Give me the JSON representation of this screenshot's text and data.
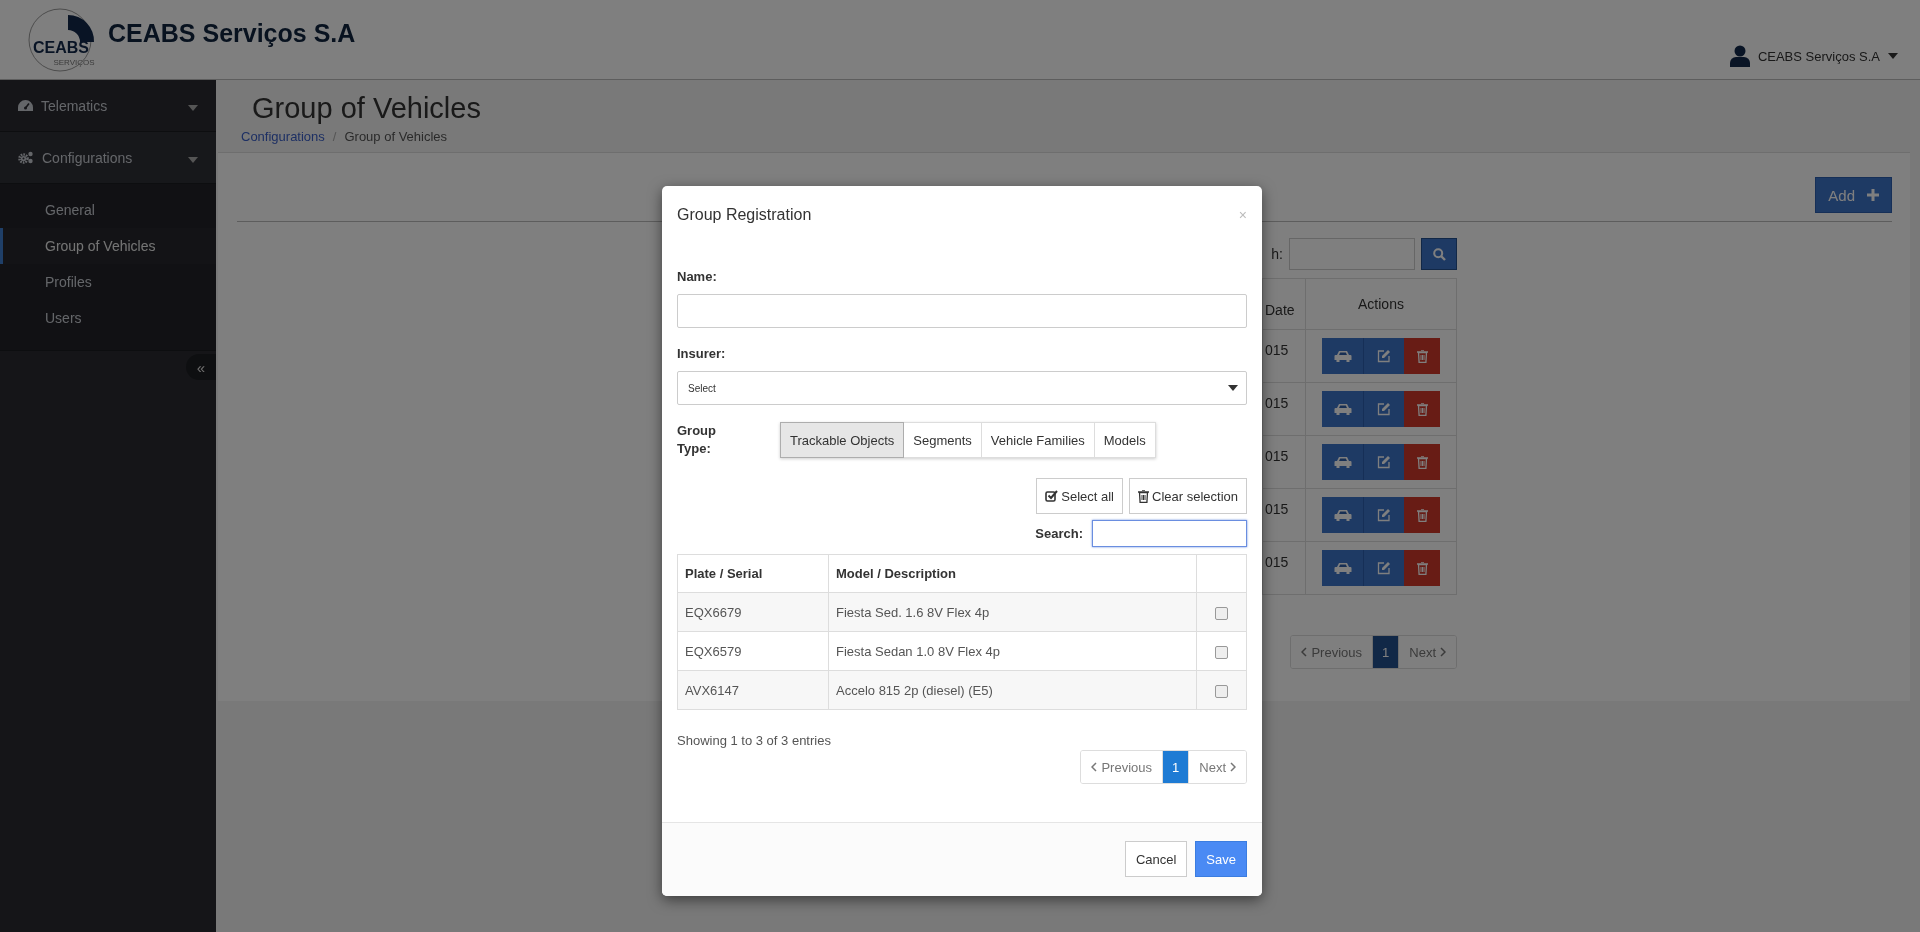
{
  "header": {
    "logo": {
      "text": "CEABS",
      "subtext": "SERVIÇOS"
    },
    "title": "CEABS Serviços S.A",
    "user": "CEABS Serviços S.A"
  },
  "sidebar": {
    "items": [
      {
        "label": "Telematics",
        "kind": "gauge"
      },
      {
        "label": "Configurations",
        "kind": "gears",
        "children": [
          {
            "label": "General",
            "selected": false
          },
          {
            "label": "Group of Vehicles",
            "selected": true
          },
          {
            "label": "Profiles",
            "selected": false
          },
          {
            "label": "Users",
            "selected": false
          }
        ]
      }
    ],
    "collapse_button": "«"
  },
  "page": {
    "title": "Group of Vehicles",
    "breadcrumb": [
      {
        "label": "Configurations",
        "kind": "link"
      },
      {
        "label": "Group of Vehicles",
        "kind": "current"
      }
    ],
    "breadcrumb_separator": "/"
  },
  "panel": {
    "add_button": "Add",
    "search_label": "h:",
    "table": {
      "columns": [
        "Date",
        "Actions"
      ],
      "rows": [
        {
          "date": "015"
        },
        {
          "date": "015"
        },
        {
          "date": "015"
        },
        {
          "date": "015"
        },
        {
          "date": "015"
        }
      ]
    },
    "pagination": {
      "previous": "Previous",
      "pages": [
        {
          "label": "1",
          "selected": true
        }
      ],
      "next": "Next"
    }
  },
  "modal": {
    "title": "Group Registration",
    "close": "×",
    "name": {
      "label": "Name:"
    },
    "insurer": {
      "label": "Insurer:",
      "value": "Select"
    },
    "group_type": {
      "label": "Group Type:",
      "tabs": [
        {
          "label": "Trackable Objects",
          "selected": true
        },
        {
          "label": "Segments",
          "selected": false
        },
        {
          "label": "Vehicle Families",
          "selected": false
        },
        {
          "label": "Models",
          "selected": false
        }
      ]
    },
    "select_all": "Select all",
    "clear_selection": "Clear selection",
    "search": {
      "label": "Search:",
      "focused": true
    },
    "table": {
      "columns": [
        "Plate / Serial",
        "Model / Description"
      ],
      "rows": [
        {
          "plate": "EQX6679",
          "model": "Fiesta Sed. 1.6 8V Flex 4p",
          "checked": false
        },
        {
          "plate": "EQX6579",
          "model": "Fiesta Sedan 1.0 8V Flex 4p",
          "checked": false
        },
        {
          "plate": "AVX6147",
          "model": "Accelo 815 2p (diesel) (E5)",
          "checked": false
        }
      ]
    },
    "info": "Showing 1 to 3 of 3 entries",
    "pagination": {
      "previous": "Previous",
      "pages": [
        {
          "label": "1",
          "selected": true
        }
      ],
      "next": "Next"
    },
    "cancel": "Cancel",
    "save": "Save"
  }
}
